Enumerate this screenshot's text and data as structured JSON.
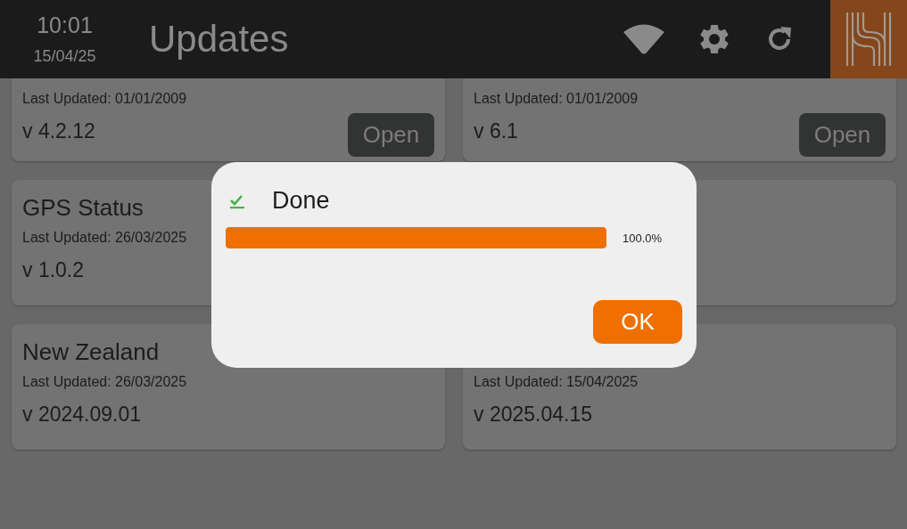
{
  "status": {
    "time": "10:01",
    "date": "15/04/25"
  },
  "title": "Updates",
  "cards": [
    {
      "kind": "entry",
      "last_updated": "Last Updated: 01/01/2009",
      "version": "v 4.2.12",
      "button": "Open"
    },
    {
      "kind": "entry",
      "last_updated": "Last Updated: 01/01/2009",
      "version": "v 6.1",
      "button": "Open"
    },
    {
      "kind": "entry",
      "title": "GPS Status",
      "last_updated": "Last Updated: 26/03/2025",
      "version": "v 1.0.2"
    },
    {
      "kind": "blank"
    },
    {
      "kind": "entry",
      "title": "New Zealand",
      "last_updated": "Last Updated: 26/03/2025",
      "version": "v 2024.09.01"
    },
    {
      "kind": "entry",
      "last_updated": "Last Updated: 15/04/2025",
      "version": "v 2025.04.15"
    }
  ],
  "dialog": {
    "kind": "done",
    "title": "Done",
    "progress": {
      "level": 1,
      "reading": "100.0%"
    },
    "button": "OK"
  }
}
